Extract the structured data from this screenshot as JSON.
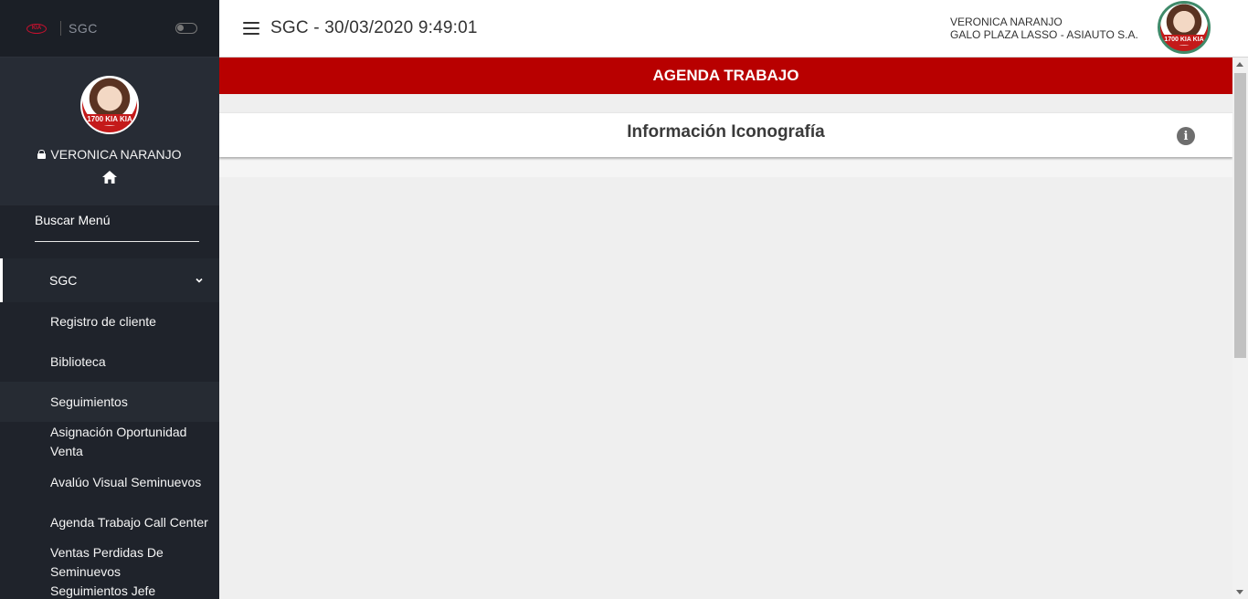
{
  "sidebar": {
    "brand_app": "SGC",
    "kia_logo_text": "KIA",
    "avatar_caption": "1700 KIA KIA",
    "user_name": "VERONICA NARANJO",
    "search_label": "Buscar Menú",
    "menu_group": "SGC",
    "items": [
      "Registro de cliente",
      "Biblioteca",
      "Seguimientos",
      "Asignación Oportunidad Venta",
      "Avalúo Visual Seminuevos",
      "Agenda Trabajo Call Center",
      "Ventas Perdidas De Seminuevos",
      "Seguimientos Jefe"
    ]
  },
  "header": {
    "title": "SGC - 30/03/2020 9:49:01",
    "user_name": "VERONICA NARANJO",
    "user_company": "GALO PLAZA LASSO - ASIAUTO S.A.",
    "avatar_caption": "1700 KIA KIA"
  },
  "main": {
    "banner": "AGENDA TRABAJO",
    "card_title": "Información Iconografía",
    "info_icon_text": "i"
  },
  "colors": {
    "sidebar_bg": "#1f232b",
    "banner_red": "#b80000",
    "content_bg": "#efefef"
  }
}
